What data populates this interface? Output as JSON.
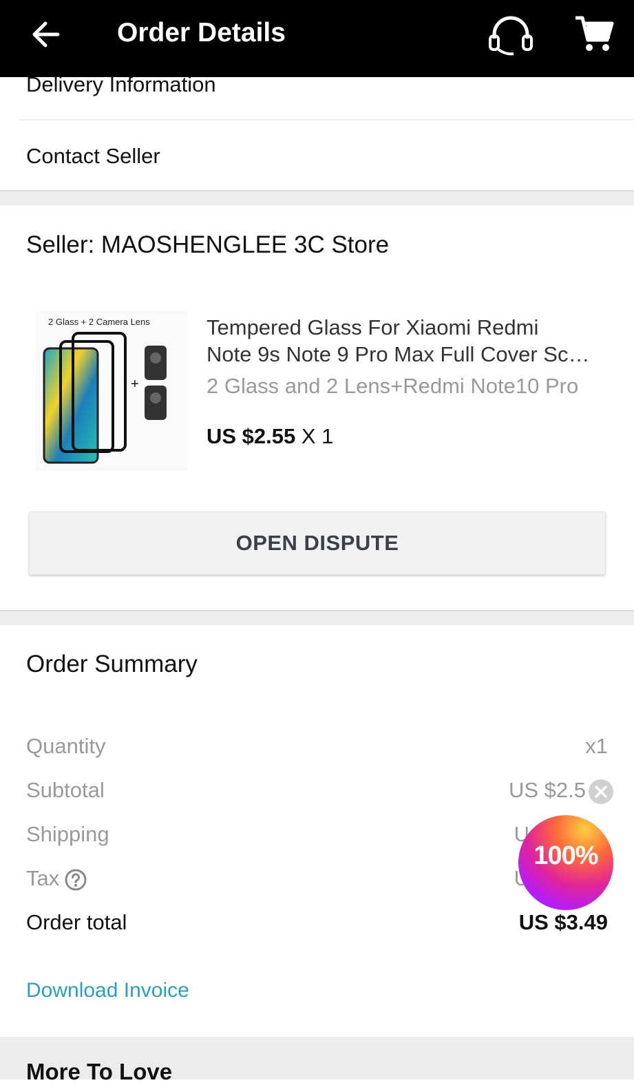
{
  "header": {
    "title": "Order Details",
    "icons": [
      "back-arrow-icon",
      "headset-icon",
      "cart-icon"
    ]
  },
  "links": {
    "delivery": "Delivery Information",
    "contact": "Contact Seller"
  },
  "seller": {
    "label": "Seller: MAOSHENGLEE 3C Store"
  },
  "product": {
    "image_caption": "2 Glass + 2 Camera Lens",
    "name_line1": "Tempered Glass For Xiaomi Redmi",
    "name_line2": "Note 9s Note 9 Pro Max Full Cover Sc…",
    "variant": "2 Glass and 2 Lens+Redmi Note10 Pro",
    "price": "US $2.55",
    "quantity": "X 1"
  },
  "actions": {
    "dispute": "OPEN DISPUTE",
    "invoice": "Download Invoice"
  },
  "summary": {
    "title": "Order Summary",
    "rows": [
      {
        "label": "Quantity",
        "value": "x1"
      },
      {
        "label": "Subtotal",
        "value": "US $2.5"
      },
      {
        "label": "Shipping",
        "value": "U"
      },
      {
        "label": "Tax",
        "value": "U"
      }
    ],
    "total_label": "Order total",
    "total_value": "US $3.49"
  },
  "promo": {
    "badge_text": "100%"
  },
  "more": {
    "title": "More To Love"
  },
  "colors": {
    "header_bg": "#000000",
    "link": "#2a9fc0",
    "muted_text": "#999999"
  }
}
